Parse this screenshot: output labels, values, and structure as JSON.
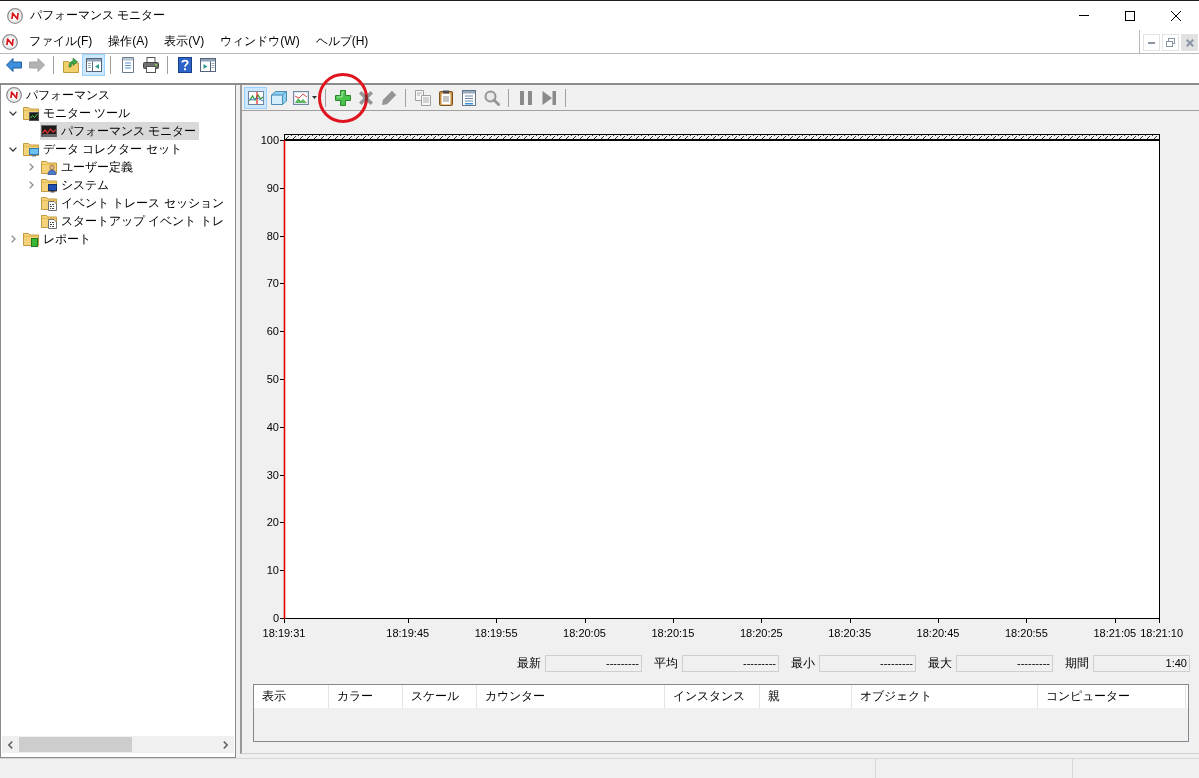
{
  "window": {
    "title": "パフォーマンス モニター"
  },
  "menu_bar": [
    "ファイル(F)",
    "操作(A)",
    "表示(V)",
    "ウィンドウ(W)",
    "ヘルプ(H)"
  ],
  "toolbar": {
    "groups": [
      [
        {
          "selected": false,
          "disabled": false
        },
        {
          "selected": false,
          "disabled": true
        }
      ],
      [
        {
          "selected": false,
          "disabled": false
        },
        {
          "selected": true,
          "disabled": false
        }
      ],
      [
        {
          "selected": false,
          "disabled": false
        },
        {
          "selected": false,
          "disabled": false
        }
      ],
      [
        {
          "selected": false,
          "disabled": false
        },
        {
          "selected": false,
          "disabled": false
        }
      ]
    ]
  },
  "tree": [
    {
      "label": "パフォーマンス",
      "selected": false,
      "children": [
        {
          "label": "モニター ツール",
          "expanded": true,
          "selected": false,
          "children": [
            {
              "label": "パフォーマンス モニター",
              "selected": true
            }
          ]
        },
        {
          "label": "データ コレクター セット",
          "expanded": true,
          "selected": false,
          "children": [
            {
              "label": "ユーザー定義",
              "expanded": false,
              "selected": false
            },
            {
              "label": "システム",
              "expanded": false,
              "selected": false
            },
            {
              "label": "イベント トレース セッション",
              "selected": false
            },
            {
              "label": "スタートアップ イベント トレ",
              "selected": false
            }
          ]
        },
        {
          "label": "レポート",
          "expanded": false,
          "selected": false
        }
      ]
    }
  ],
  "chart_toolbar": {
    "groups": [
      [
        {
          "kind": "button",
          "selected": true,
          "disabled": false,
          "circled": false
        },
        {
          "kind": "button",
          "selected": false,
          "disabled": false,
          "circled": false
        },
        {
          "kind": "dropdown",
          "selected": false,
          "disabled": false,
          "circled": false
        }
      ],
      [
        {
          "kind": "button",
          "selected": false,
          "disabled": false,
          "circled": true
        },
        {
          "kind": "button",
          "selected": false,
          "disabled": true,
          "circled": false
        },
        {
          "kind": "button",
          "selected": false,
          "disabled": true,
          "circled": false
        }
      ],
      [
        {
          "kind": "button",
          "selected": false,
          "disabled": true,
          "circled": false
        },
        {
          "kind": "button",
          "selected": false,
          "disabled": false,
          "circled": false
        },
        {
          "kind": "button",
          "selected": false,
          "disabled": false,
          "circled": false
        },
        {
          "kind": "button",
          "selected": false,
          "disabled": true,
          "circled": false
        }
      ],
      [
        {
          "kind": "button",
          "selected": false,
          "disabled": false,
          "circled": false
        },
        {
          "kind": "button",
          "selected": false,
          "disabled": false,
          "circled": false
        }
      ]
    ]
  },
  "graph": {
    "chart_data": {
      "type": "line",
      "categories": [
        "18:19:31",
        null,
        null,
        null,
        null,
        null,
        null,
        null,
        null,
        null,
        null,
        null,
        null,
        null,
        "18:19:45",
        null,
        null,
        null,
        null,
        null,
        null,
        null,
        null,
        null,
        "18:19:55",
        null,
        null,
        null,
        null,
        null,
        null,
        null,
        null,
        null,
        "18:20:05",
        null,
        null,
        null,
        null,
        null,
        null,
        null,
        null,
        null,
        "18:20:15",
        null,
        null,
        null,
        null,
        null,
        null,
        null,
        null,
        null,
        "18:20:25",
        null,
        null,
        null,
        null,
        null,
        null,
        null,
        null,
        null,
        "18:20:35",
        null,
        null,
        null,
        null,
        null,
        null,
        null,
        null,
        null,
        "18:20:45",
        null,
        null,
        null,
        null,
        null,
        null,
        null,
        null,
        null,
        "18:20:55",
        null,
        null,
        null,
        null,
        null,
        null,
        null,
        null,
        null,
        "18:21:05",
        null,
        null,
        null,
        null,
        "18:21:10"
      ],
      "ylim": [
        0,
        100
      ],
      "yticks": [
        0,
        10,
        20,
        30,
        40,
        50,
        60,
        70,
        80,
        90,
        100
      ]
    }
  },
  "statistics": [
    {
      "label": "最新",
      "value": "---------"
    },
    {
      "label": "平均",
      "value": "---------"
    },
    {
      "label": "最小",
      "value": "---------"
    },
    {
      "label": "最大",
      "value": "---------"
    },
    {
      "label": "期間",
      "value": "1:40"
    }
  ],
  "legend": {
    "columns": [
      "表示",
      "カラー",
      "スケール",
      "カウンター",
      "インスタンス",
      "親",
      "オブジェクト",
      "コンピューター"
    ]
  }
}
